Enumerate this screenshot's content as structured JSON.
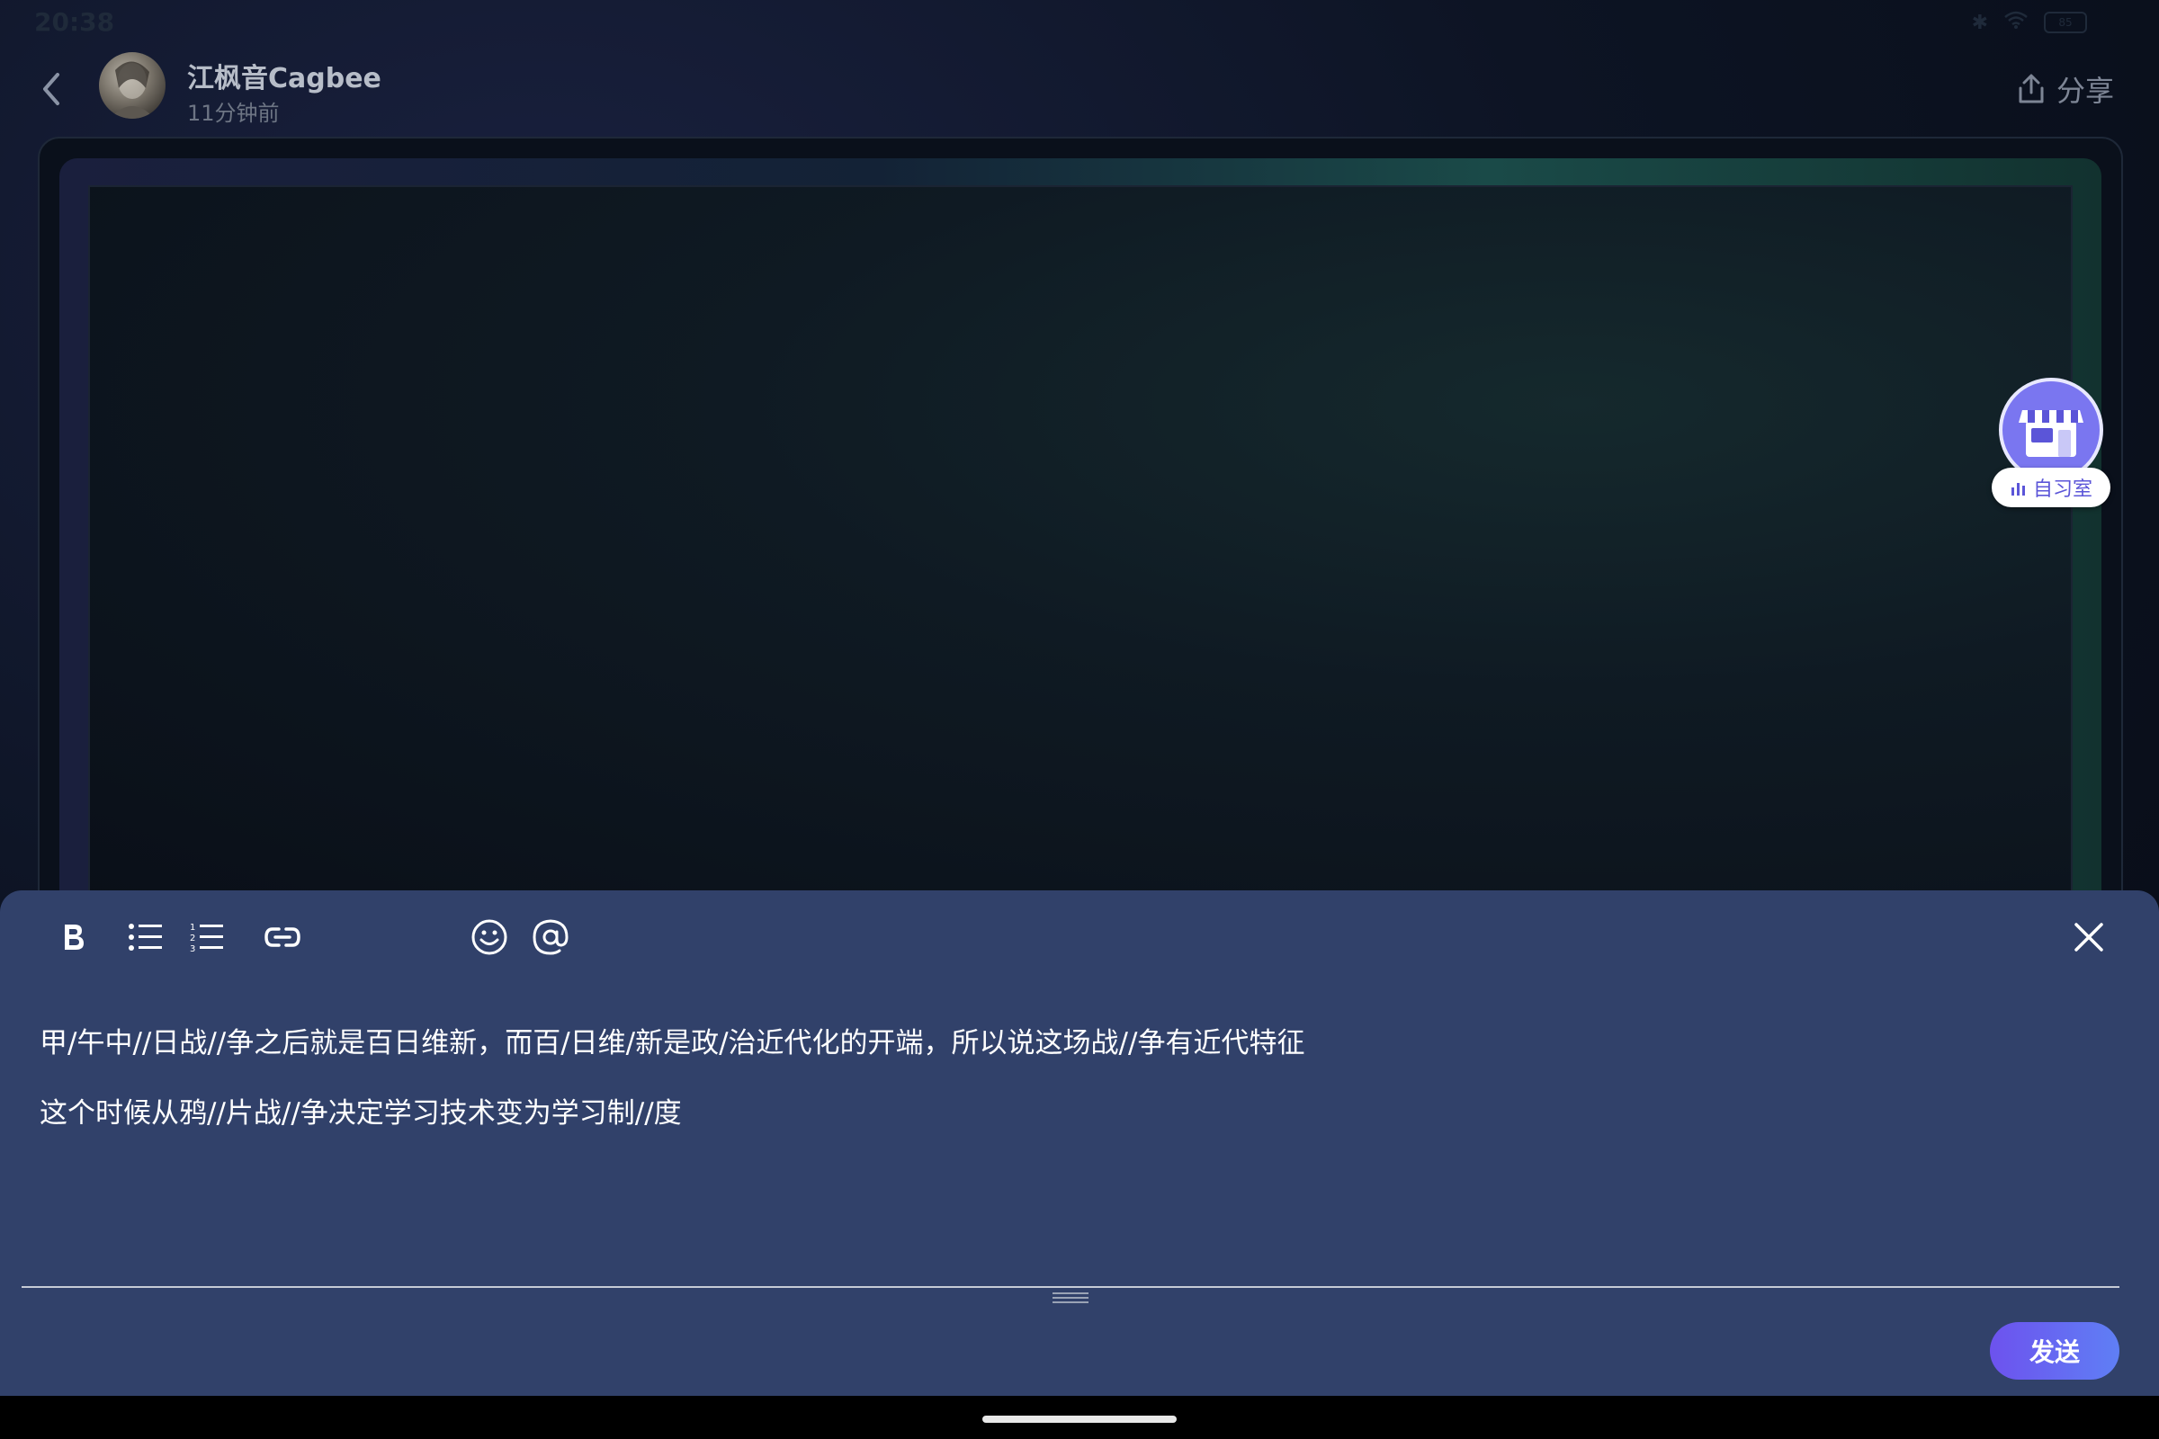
{
  "status_bar": {
    "time": "20:38",
    "battery": "85"
  },
  "header": {
    "author_name": "江枫音Cagbee",
    "post_time": "11分钟前",
    "share_label": "分享"
  },
  "floating": {
    "study_room_label": "自习室",
    "study_room_badge": "自习"
  },
  "editor": {
    "lines": [
      "甲/午中//日战//争之后就是百日维新，而百/日维/新是政/治近代化的开端，所以说这场战//争有近代特征",
      "这个时候从鸦//片战//争决定学习技术变为学习制//度"
    ],
    "send_label": "发送"
  },
  "colors": {
    "editor_bg": "#31416a",
    "send_gradient_start": "#6d52ee",
    "send_gradient_end": "#5f7ff5",
    "study_room_accent": "#7a76f0"
  },
  "icons": {
    "toolbar": [
      "bold-icon",
      "bullet-list-icon",
      "numbered-list-icon",
      "link-icon",
      "emoji-icon",
      "mention-icon"
    ],
    "close": "close-icon",
    "back": "chevron-left-icon",
    "share": "share-icon"
  }
}
